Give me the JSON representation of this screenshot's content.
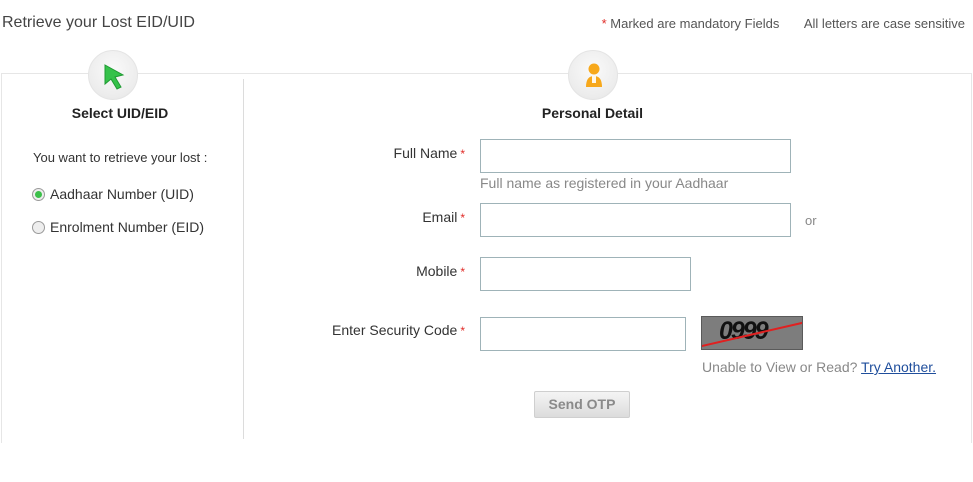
{
  "header": {
    "title": "Retrieve your Lost EID/UID",
    "mandatory_star": "*",
    "mandatory_note": "Marked are mandatory Fields",
    "case_note": "All letters are case sensitive"
  },
  "left_panel": {
    "icon": "cursor-arrow-icon",
    "title": "Select UID/EID",
    "prompt": "You want to retrieve your lost :",
    "options": [
      {
        "label": "Aadhaar Number (UID)",
        "selected": true
      },
      {
        "label": "Enrolment Number (EID)",
        "selected": false
      }
    ]
  },
  "right_panel": {
    "icon": "person-icon",
    "title": "Personal Detail",
    "required_mark": "*",
    "fields": {
      "full_name": {
        "label": "Full Name",
        "value": "",
        "hint": "Full name as registered in your Aadhaar"
      },
      "email": {
        "label": "Email",
        "value": "",
        "suffix": "or"
      },
      "mobile": {
        "label": "Mobile",
        "value": ""
      },
      "security_code": {
        "label": "Enter Security Code",
        "value": ""
      }
    },
    "captcha": {
      "text": "0999"
    },
    "captcha_help": {
      "prefix": "Unable to View or Read?",
      "link": "Try Another."
    },
    "submit_label": "Send OTP"
  },
  "colors": {
    "required": "#e02b27",
    "selected_radio": "#3cc04a",
    "link": "#1f4e9c"
  }
}
